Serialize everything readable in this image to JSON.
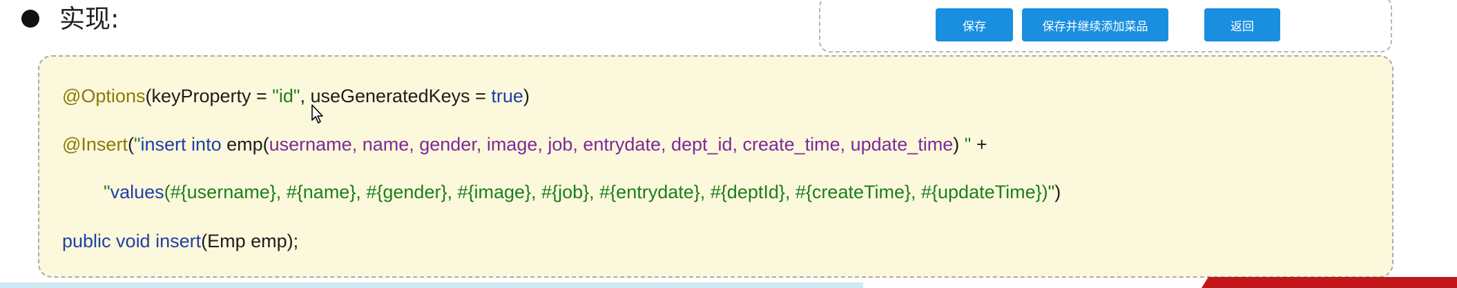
{
  "heading": {
    "text": "实现:"
  },
  "form_buttons": {
    "save": "保存",
    "save_continue": "保存并继续添加菜品",
    "back": "返回"
  },
  "code": {
    "line1": {
      "annotation": "@Options",
      "open": "(keyProperty = ",
      "str": "\"id\"",
      "mid": ", useGeneratedKeys = ",
      "kw": "true",
      "close": ")"
    },
    "line2": {
      "annotation": "@Insert",
      "open": "(",
      "str_start": "\"",
      "kw": "insert into",
      "table": " emp(",
      "columns": "username, name, gender, image, job, entrydate, dept_id, create_time, update_time",
      "close": ")",
      "str_end": " \"",
      "plus": " +"
    },
    "line3": {
      "str_start": "\"",
      "kw": "values",
      "values": "(#{username}, #{name}, #{gender}, #{image}, #{job}, #{entrydate}, #{deptId}, #{createTime}, #{updateTime})\"",
      "close": ")"
    },
    "line4": {
      "kw": "public void insert",
      "rest": "(Emp emp);"
    }
  },
  "colors": {
    "button_blue": "#1a8fe0",
    "code_background": "#fcf8dc",
    "annotation": "#8a7a00",
    "keyword": "#1f3fa6",
    "string": "#1a7f1a",
    "column": "#7b2a9a"
  },
  "icons": [
    "bullet-icon",
    "mouse-cursor-icon"
  ]
}
